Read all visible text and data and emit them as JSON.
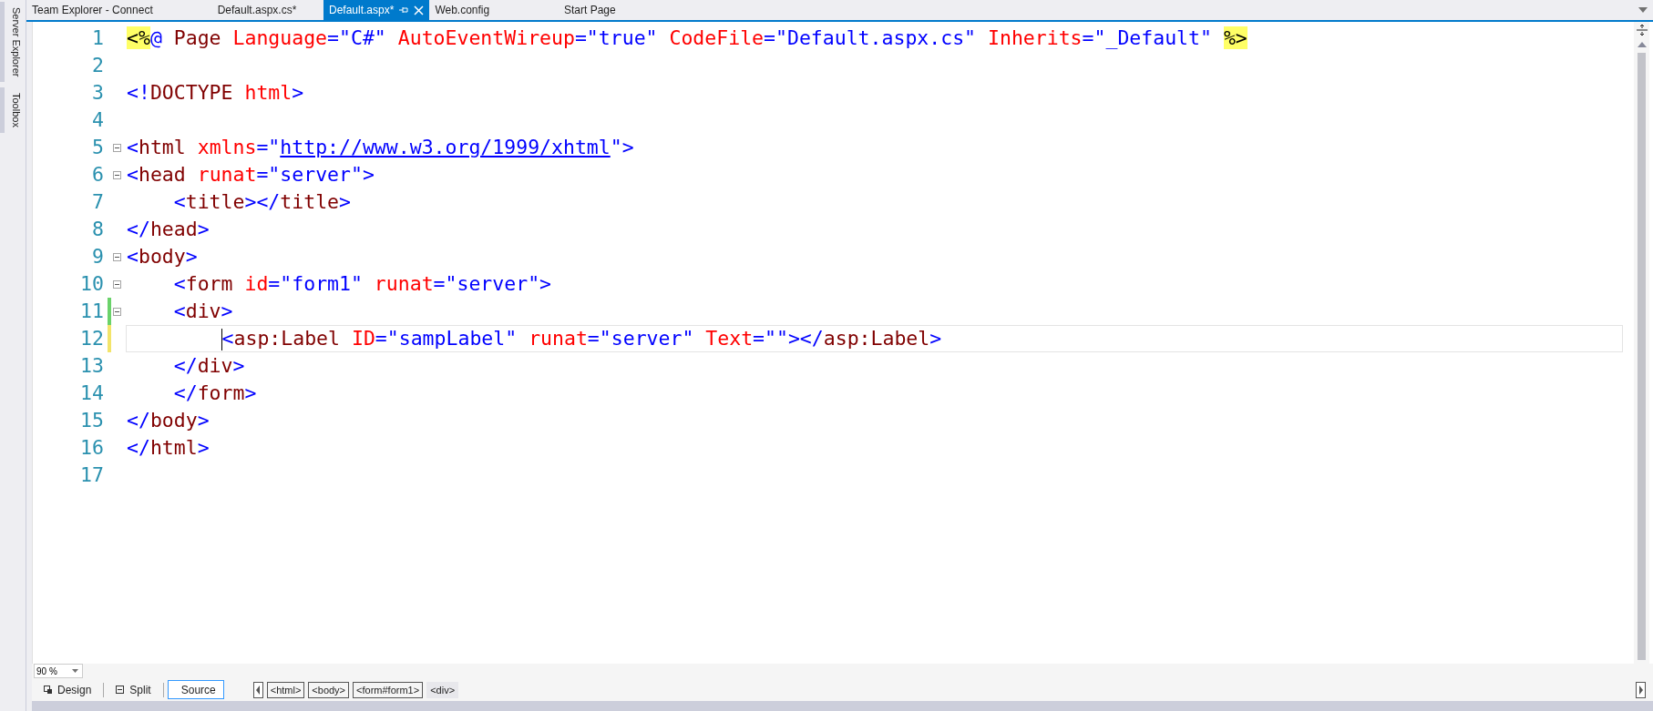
{
  "side_panels": [
    "Server Explorer",
    "Toolbox"
  ],
  "tabs": [
    {
      "label": "Team Explorer - Connect",
      "selected": false
    },
    {
      "label": "Default.aspx.cs*",
      "selected": false
    },
    {
      "label": "Default.aspx*",
      "selected": true
    },
    {
      "label": "Web.config",
      "selected": false
    },
    {
      "label": "Start Page",
      "selected": false
    }
  ],
  "editor": {
    "lines": [
      {
        "number": "1",
        "tokens": [
          {
            "kind": "highlight",
            "t": "<%"
          },
          {
            "kind": "delimiter",
            "t": "@ "
          },
          {
            "kind": "element",
            "t": "Page "
          },
          {
            "kind": "attribute",
            "t": "Language"
          },
          {
            "kind": "value",
            "t": "=\"C#\" "
          },
          {
            "kind": "attribute",
            "t": "AutoEventWireup"
          },
          {
            "kind": "value",
            "t": "=\"true\" "
          },
          {
            "kind": "attribute",
            "t": "CodeFile"
          },
          {
            "kind": "value",
            "t": "=\"Default.aspx.cs\" "
          },
          {
            "kind": "attribute",
            "t": "Inherits"
          },
          {
            "kind": "value",
            "t": "=\"_Default\" "
          },
          {
            "kind": "highlight",
            "t": "%>"
          }
        ]
      },
      {
        "number": "2"
      },
      {
        "number": "3",
        "tokens": [
          {
            "kind": "delimiter",
            "t": "<!"
          },
          {
            "kind": "element",
            "t": "DOCTYPE "
          },
          {
            "kind": "attribute",
            "t": "html"
          },
          {
            "kind": "delimiter",
            "t": ">"
          }
        ]
      },
      {
        "number": "4"
      },
      {
        "number": "5",
        "fold": true,
        "tokens": [
          {
            "kind": "delimiter",
            "t": "<"
          },
          {
            "kind": "element",
            "t": "html "
          },
          {
            "kind": "attribute",
            "t": "xmlns"
          },
          {
            "kind": "delimiter",
            "t": "=\""
          },
          {
            "kind": "link",
            "t": "http://www.w3.org/1999/xhtml"
          },
          {
            "kind": "delimiter",
            "t": "\">"
          }
        ]
      },
      {
        "number": "6",
        "fold": true,
        "tokens": [
          {
            "kind": "delimiter",
            "t": "<"
          },
          {
            "kind": "element",
            "t": "head "
          },
          {
            "kind": "attribute",
            "t": "runat"
          },
          {
            "kind": "value",
            "t": "=\"server\">"
          }
        ]
      },
      {
        "number": "7",
        "tokens": [
          {
            "kind": "delimiter",
            "t": "    <"
          },
          {
            "kind": "element",
            "t": "title"
          },
          {
            "kind": "delimiter",
            "t": "></"
          },
          {
            "kind": "element",
            "t": "title"
          },
          {
            "kind": "delimiter",
            "t": ">"
          }
        ]
      },
      {
        "number": "8",
        "tokens": [
          {
            "kind": "delimiter",
            "t": "</"
          },
          {
            "kind": "element",
            "t": "head"
          },
          {
            "kind": "delimiter",
            "t": ">"
          }
        ]
      },
      {
        "number": "9",
        "fold": true,
        "tokens": [
          {
            "kind": "delimiter",
            "t": "<"
          },
          {
            "kind": "element",
            "t": "body"
          },
          {
            "kind": "delimiter",
            "t": ">"
          }
        ]
      },
      {
        "number": "10",
        "fold": true,
        "tokens": [
          {
            "kind": "delimiter",
            "t": "    <"
          },
          {
            "kind": "element",
            "t": "form "
          },
          {
            "kind": "attribute",
            "t": "id"
          },
          {
            "kind": "value",
            "t": "=\"form1\" "
          },
          {
            "kind": "attribute",
            "t": "runat"
          },
          {
            "kind": "value",
            "t": "=\"server\">"
          }
        ]
      },
      {
        "number": "11",
        "fold": true,
        "color": "#6ad26a",
        "tokens": [
          {
            "kind": "delimiter",
            "t": "    <"
          },
          {
            "kind": "element",
            "t": "div"
          },
          {
            "kind": "delimiter",
            "t": ">"
          }
        ]
      },
      {
        "number": "12",
        "color": "#f3e46a",
        "current": true,
        "tokens": [
          {
            "kind": "caret"
          },
          {
            "kind": "delimiter",
            "t": "<"
          },
          {
            "kind": "element",
            "t": "asp:Label "
          },
          {
            "kind": "attribute",
            "t": "ID"
          },
          {
            "kind": "value",
            "t": "=\"sampLabel\" "
          },
          {
            "kind": "attribute",
            "t": "runat"
          },
          {
            "kind": "value",
            "t": "=\"server\" "
          },
          {
            "kind": "attribute",
            "t": "Text"
          },
          {
            "kind": "value",
            "t": "=\"\"></"
          },
          {
            "kind": "element",
            "t": "asp:Label"
          },
          {
            "kind": "delimiter",
            "t": ">"
          }
        ]
      },
      {
        "number": "13",
        "tokens": [
          {
            "kind": "delimiter",
            "t": "    </"
          },
          {
            "kind": "element",
            "t": "div"
          },
          {
            "kind": "delimiter",
            "t": ">"
          }
        ]
      },
      {
        "number": "14",
        "tokens": [
          {
            "kind": "delimiter",
            "t": "    </"
          },
          {
            "kind": "element",
            "t": "form"
          },
          {
            "kind": "delimiter",
            "t": ">"
          }
        ]
      },
      {
        "number": "15",
        "tokens": [
          {
            "kind": "delimiter",
            "t": "</"
          },
          {
            "kind": "element",
            "t": "body"
          },
          {
            "kind": "delimiter",
            "t": ">"
          }
        ]
      },
      {
        "number": "16",
        "tokens": [
          {
            "kind": "delimiter",
            "t": "</"
          },
          {
            "kind": "element",
            "t": "html"
          },
          {
            "kind": "delimiter",
            "t": ">"
          }
        ]
      },
      {
        "number": "17"
      }
    ]
  },
  "zoom": "90 %",
  "views": [
    {
      "label": "Design",
      "kind": "design",
      "selected": false
    },
    {
      "label": "Split",
      "kind": "split",
      "selected": false
    },
    {
      "label": "Source",
      "kind": "source",
      "selected": true
    }
  ],
  "breadcrumbs": [
    {
      "label": "<html>",
      "selected": false
    },
    {
      "label": "<body>",
      "selected": false
    },
    {
      "label": "<form#form1>",
      "selected": false
    },
    {
      "label": "<div>",
      "selected": true
    }
  ]
}
